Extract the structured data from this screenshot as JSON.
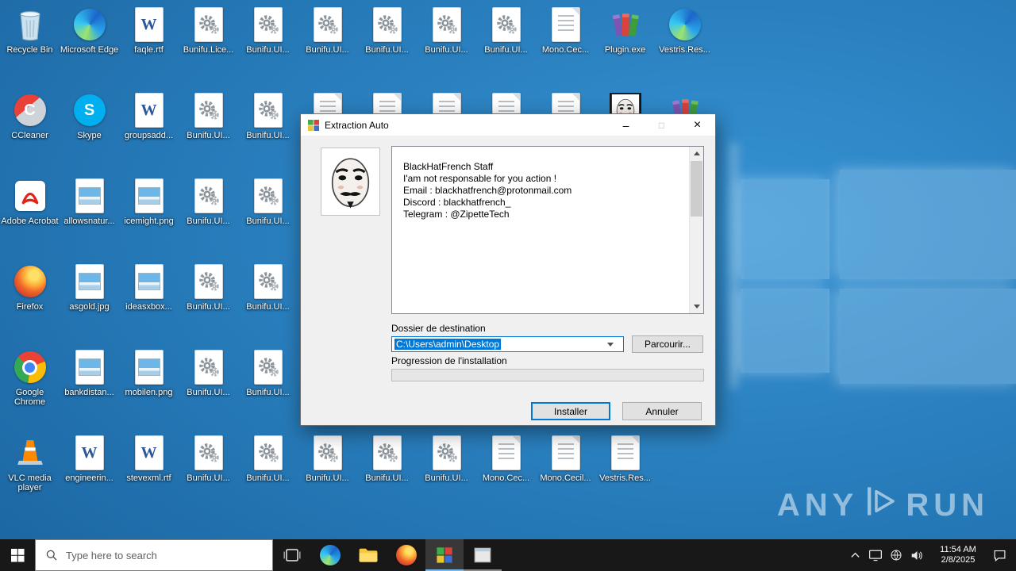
{
  "colors": {
    "accent": "#0078d7",
    "selection_highlight": "#0078d7",
    "desktop_blue": "#2578b6",
    "taskbar_background": "#181818",
    "dialog_background": "#f0f0f0"
  },
  "desktop": {
    "icons": [
      {
        "label": "Recycle Bin",
        "type": "recycle",
        "col": 0,
        "row": 0
      },
      {
        "label": "Microsoft Edge",
        "type": "edge",
        "col": 1,
        "row": 0
      },
      {
        "label": "faqle.rtf",
        "type": "word",
        "col": 2,
        "row": 0
      },
      {
        "label": "Bunifu.Lice...",
        "type": "gear",
        "col": 3,
        "row": 0
      },
      {
        "label": "Bunifu.UI...",
        "type": "gear",
        "col": 4,
        "row": 0
      },
      {
        "label": "Bunifu.UI...",
        "type": "gear",
        "col": 5,
        "row": 0
      },
      {
        "label": "Bunifu.UI...",
        "type": "gear",
        "col": 6,
        "row": 0
      },
      {
        "label": "Bunifu.UI...",
        "type": "gear",
        "col": 7,
        "row": 0
      },
      {
        "label": "Bunifu.UI...",
        "type": "gear",
        "col": 8,
        "row": 0
      },
      {
        "label": "Mono.Cec...",
        "type": "page",
        "col": 9,
        "row": 0
      },
      {
        "label": "Plugin.exe",
        "type": "winrar",
        "col": 10,
        "row": 0
      },
      {
        "label": "Vestris.Res...",
        "type": "edge",
        "col": 11,
        "row": 0
      },
      {
        "label": "CCleaner",
        "type": "ccleaner",
        "col": 0,
        "row": 1
      },
      {
        "label": "Skype",
        "type": "skype",
        "col": 1,
        "row": 1
      },
      {
        "label": "groupsadd...",
        "type": "word",
        "col": 2,
        "row": 1
      },
      {
        "label": "Bunifu.UI...",
        "type": "gear",
        "col": 3,
        "row": 1
      },
      {
        "label": "Bunifu.UI...",
        "type": "gear",
        "col": 4,
        "row": 1
      },
      {
        "label": "",
        "type": "page",
        "col": 5,
        "row": 1
      },
      {
        "label": "",
        "type": "page",
        "col": 6,
        "row": 1
      },
      {
        "label": "",
        "type": "page",
        "col": 7,
        "row": 1
      },
      {
        "label": "",
        "type": "page",
        "col": 8,
        "row": 1
      },
      {
        "label": "",
        "type": "page",
        "col": 9,
        "row": 1
      },
      {
        "label": "",
        "type": "mask",
        "col": 10,
        "row": 1
      },
      {
        "label": "",
        "type": "winrar",
        "col": 11,
        "row": 1
      },
      {
        "label": "Adobe Acrobat",
        "type": "acrobat",
        "col": 0,
        "row": 2
      },
      {
        "label": "allowsnatur...",
        "type": "image",
        "col": 1,
        "row": 2
      },
      {
        "label": "icemight.png",
        "type": "image",
        "col": 2,
        "row": 2
      },
      {
        "label": "Bunifu.UI...",
        "type": "gear",
        "col": 3,
        "row": 2
      },
      {
        "label": "Bunifu.UI...",
        "type": "gear",
        "col": 4,
        "row": 2
      },
      {
        "label": "Firefox",
        "type": "firefox",
        "col": 0,
        "row": 3
      },
      {
        "label": "asgold.jpg",
        "type": "image",
        "col": 1,
        "row": 3
      },
      {
        "label": "ideasxbox...",
        "type": "image",
        "col": 2,
        "row": 3
      },
      {
        "label": "Bunifu.UI...",
        "type": "gear",
        "col": 3,
        "row": 3
      },
      {
        "label": "Bunifu.UI...",
        "type": "gear",
        "col": 4,
        "row": 3
      },
      {
        "label": "Google Chrome",
        "type": "chrome",
        "col": 0,
        "row": 4
      },
      {
        "label": "bankdistan...",
        "type": "image",
        "col": 1,
        "row": 4
      },
      {
        "label": "mobilen.png",
        "type": "image",
        "col": 2,
        "row": 4
      },
      {
        "label": "Bunifu.UI...",
        "type": "gear",
        "col": 3,
        "row": 4
      },
      {
        "label": "Bunifu.UI...",
        "type": "gear",
        "col": 4,
        "row": 4
      },
      {
        "label": "VLC media player",
        "type": "vlc",
        "col": 0,
        "row": 5
      },
      {
        "label": "engineerin...",
        "type": "word",
        "col": 1,
        "row": 5
      },
      {
        "label": "stevexml.rtf",
        "type": "word",
        "col": 2,
        "row": 5
      },
      {
        "label": "Bunifu.UI...",
        "type": "gear",
        "col": 3,
        "row": 5
      },
      {
        "label": "Bunifu.UI...",
        "type": "gear",
        "col": 4,
        "row": 5
      },
      {
        "label": "Bunifu.UI...",
        "type": "gear",
        "col": 5,
        "row": 5
      },
      {
        "label": "Bunifu.UI...",
        "type": "gear",
        "col": 6,
        "row": 5
      },
      {
        "label": "Bunifu.UI...",
        "type": "gear",
        "col": 7,
        "row": 5
      },
      {
        "label": "Mono.Cec...",
        "type": "page",
        "col": 8,
        "row": 5
      },
      {
        "label": "Mono.Cecil...",
        "type": "page",
        "col": 9,
        "row": 5
      },
      {
        "label": "Vestris.Res...",
        "type": "page",
        "col": 10,
        "row": 5
      }
    ]
  },
  "dialog": {
    "title": "Extraction Auto",
    "message_lines": [
      "BlackHatFrench Staff",
      "I'am not responsable for you action !",
      "Email : blackhatfrench@protonmail.com",
      "Discord : blackhatfrench_",
      "Telegram : @ZipetteTech"
    ],
    "destination_label": "Dossier de destination",
    "destination_value": "C:\\Users\\admin\\Desktop",
    "browse_button": "Parcourir...",
    "progress_label": "Progression de l'installation",
    "progress_value": 0,
    "install_button": "Installer",
    "cancel_button": "Annuler",
    "window_buttons": {
      "minimize": "–",
      "maximize": "□",
      "close": "×"
    }
  },
  "taskbar": {
    "search_placeholder": "Type here to search",
    "time": "11:54 AM",
    "date": "2/8/2025",
    "app_icons": [
      "start",
      "search",
      "task-view",
      "edge",
      "file-explorer",
      "firefox",
      "extraction-auto-active",
      "window-app"
    ],
    "tray_icons": [
      "hidden-icons-chevron",
      "display",
      "network",
      "volume",
      "action-center"
    ]
  },
  "watermark": {
    "left": "ANY",
    "right": "RUN"
  }
}
